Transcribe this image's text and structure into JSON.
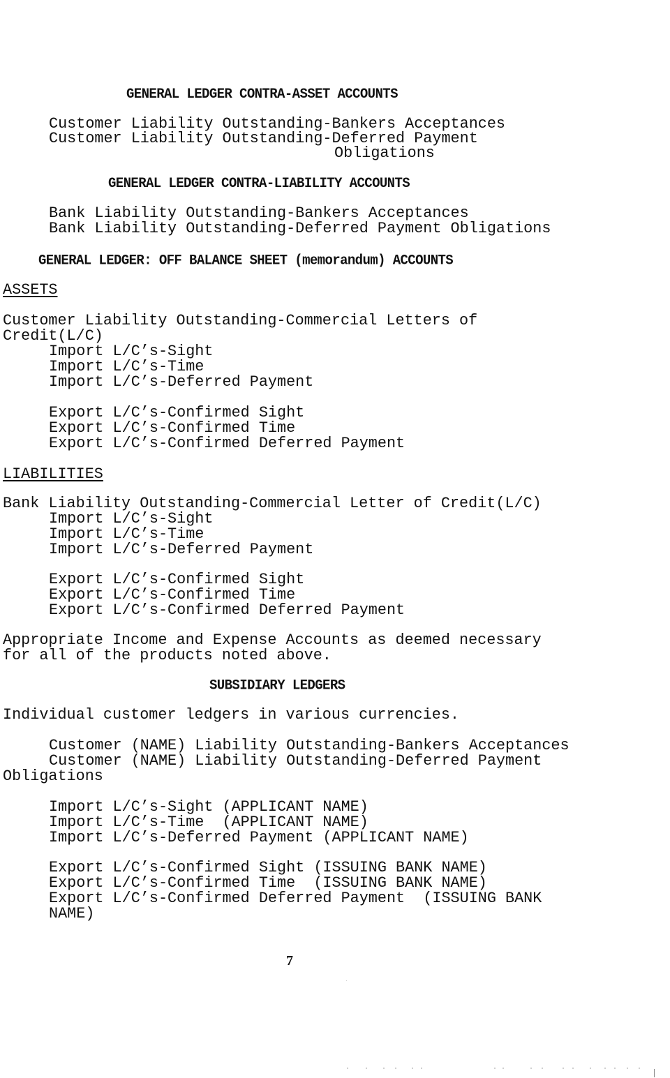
{
  "sections": {
    "contra_asset": {
      "heading": "GENERAL LEDGER CONTRA-ASSET ACCOUNTS",
      "lines": [
        "Customer Liability Outstanding-Bankers Acceptances",
        "Customer Liability Outstanding-Deferred Payment",
        "Obligations"
      ]
    },
    "contra_liability": {
      "heading": "GENERAL LEDGER CONTRA-LIABILITY ACCOUNTS",
      "lines": [
        "Bank Liability Outstanding-Bankers Acceptances",
        "Bank Liability Outstanding-Deferred Payment Obligations"
      ]
    },
    "off_balance": {
      "heading": "GENERAL LEDGER: OFF BALANCE SHEET (memorandum) ACCOUNTS",
      "assets": {
        "label": "ASSETS",
        "title_line1": "Customer Liability Outstanding-Commercial Letters of",
        "title_line2": "Credit(L/C)",
        "import_items": [
          "Import L/C’s-Sight",
          "Import L/C’s-Time",
          "Import L/C’s-Deferred Payment"
        ],
        "export_items": [
          "Export L/C’s-Confirmed Sight",
          "Export L/C’s-Confirmed Time",
          "Export L/C’s-Confirmed Deferred Payment"
        ]
      },
      "liabilities": {
        "label": "LIABILITIES",
        "title_line1": "Bank Liability Outstanding-Commercial Letter of Credit(L/C)",
        "import_items": [
          "Import L/C’s-Sight",
          "Import L/C’s-Time",
          "Import L/C’s-Deferred Payment"
        ],
        "export_items": [
          "Export L/C’s-Confirmed Sight",
          "Export L/C’s-Confirmed Time",
          "Export L/C’s-Confirmed Deferred Payment"
        ]
      },
      "note_line1": "Appropriate Income and Expense Accounts as deemed necessary",
      "note_line2": "for all of the products noted above."
    },
    "subsidiary": {
      "heading": "SUBSIDIARY LEDGERS",
      "intro": "Individual customer ledgers in various currencies.",
      "customer_lines": [
        "Customer (NAME) Liability Outstanding-Bankers Acceptances",
        "Customer (NAME) Liability Outstanding-Deferred Payment",
        "Obligations"
      ],
      "import_items": [
        "Import L/C’s-Sight (APPLICANT NAME)",
        "Import L/C’s-Time  (APPLICANT NAME)",
        "Import L/C’s-Deferred Payment (APPLICANT NAME)"
      ],
      "export_items": [
        "Export L/C’s-Confirmed Sight (ISSUING BANK NAME)",
        "Export L/C’s-Confirmed Time  (ISSUING BANK NAME)",
        "Export L/C’s-Confirmed Deferred Payment  (ISSUING BANK",
        "NAME)"
      ]
    }
  },
  "page_number": "7"
}
